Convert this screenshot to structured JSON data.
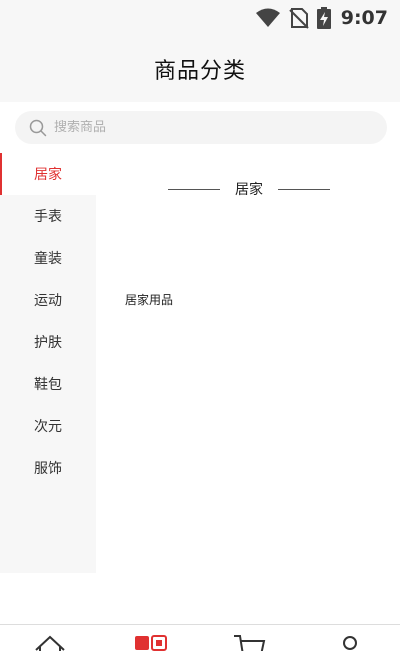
{
  "status_bar": {
    "time": "9:07",
    "icons": [
      "wifi-icon",
      "no-sim-icon",
      "battery-charging-icon"
    ]
  },
  "header": {
    "title": "商品分类"
  },
  "search": {
    "placeholder": "搜索商品",
    "value": ""
  },
  "sidebar": {
    "items": [
      {
        "label": "居家",
        "active": true
      },
      {
        "label": "手表",
        "active": false
      },
      {
        "label": "童装",
        "active": false
      },
      {
        "label": "运动",
        "active": false
      },
      {
        "label": "护肤",
        "active": false
      },
      {
        "label": "鞋包",
        "active": false
      },
      {
        "label": "次元",
        "active": false
      },
      {
        "label": "服饰",
        "active": false
      }
    ]
  },
  "content": {
    "section_title": "居家",
    "items": [
      {
        "label": "居家用品"
      }
    ]
  },
  "bottom_nav": {
    "items": [
      {
        "icon": "home-icon",
        "active": false
      },
      {
        "icon": "category-icon",
        "active": true
      },
      {
        "icon": "cart-icon",
        "active": false
      },
      {
        "icon": "profile-icon",
        "active": false
      }
    ]
  },
  "colors": {
    "accent": "#e03131",
    "sidebar_bg": "#f7f7f7",
    "search_bg": "#f4f4f4",
    "text": "#333333"
  }
}
